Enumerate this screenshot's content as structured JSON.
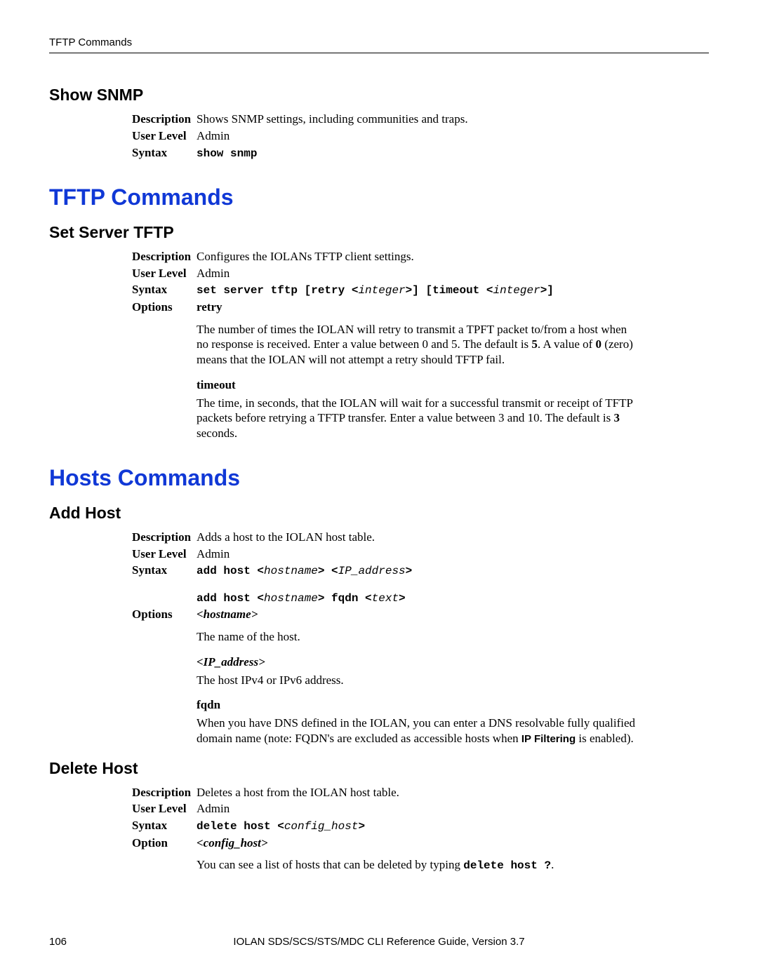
{
  "header": {
    "running": "TFTP Commands"
  },
  "show_snmp": {
    "heading": "Show SNMP",
    "desc_label": "Description",
    "desc": "Shows SNMP settings, including communities and traps.",
    "user_level_label": "User Level",
    "user_level": "Admin",
    "syntax_label": "Syntax",
    "syntax": "show snmp"
  },
  "tftp": {
    "heading": "TFTP Commands",
    "set_server": {
      "heading": "Set Server TFTP",
      "desc_label": "Description",
      "desc": "Configures the IOLANs TFTP client settings.",
      "user_level_label": "User Level",
      "user_level": "Admin",
      "syntax_label": "Syntax",
      "syntax_pre": "set server tftp [retry <",
      "syntax_i1": "integer",
      "syntax_mid": ">] [timeout <",
      "syntax_i2": "integer",
      "syntax_post": ">]",
      "options_label": "Options",
      "retry": {
        "title": "retry",
        "desc_pre": "The number of times the IOLAN will retry to transmit a TPFT packet to/from a host when no response is received. Enter a value between 0 and 5. The default is ",
        "desc_bold1": "5",
        "desc_mid": ". A value of ",
        "desc_bold2": "0",
        "desc_post": " (zero) means that the IOLAN will not attempt a retry should TFTP fail."
      },
      "timeout": {
        "title": "timeout",
        "desc_pre": "The time, in seconds, that the IOLAN will wait for a successful transmit or receipt of TFTP packets before retrying a TFTP transfer. Enter a value between 3 and 10. The default is ",
        "desc_bold": "3",
        "desc_post": " seconds."
      }
    }
  },
  "hosts": {
    "heading": "Hosts Commands",
    "add_host": {
      "heading": "Add Host",
      "desc_label": "Description",
      "desc": "Adds a host to the IOLAN host table.",
      "user_level_label": "User Level",
      "user_level": "Admin",
      "syntax_label": "Syntax",
      "syntax1_pre": "add host <",
      "syntax1_i1": "hostname",
      "syntax1_mid": "> <",
      "syntax1_i2": "IP_address",
      "syntax1_post": ">",
      "syntax2_pre": "add host <",
      "syntax2_i1": "hostname",
      "syntax2_mid": "> fqdn <",
      "syntax2_i2": "text",
      "syntax2_post": ">",
      "options_label": "Options",
      "opt_hostname": {
        "title": "<hostname>",
        "desc": "The name of the host."
      },
      "opt_ip": {
        "title": "<IP_address>",
        "desc": "The host IPv4 or IPv6 address."
      },
      "opt_fqdn": {
        "title": "fqdn",
        "desc_pre": "When you have DNS defined in the IOLAN, you can enter a DNS resolvable fully qualified domain name (note: FQDN's are excluded as accessible hosts when ",
        "desc_bold": "IP Filtering",
        "desc_post": " is enabled)."
      }
    },
    "delete_host": {
      "heading": "Delete Host",
      "desc_label": "Description",
      "desc": "Deletes a host from the IOLAN host table.",
      "user_level_label": "User Level",
      "user_level": "Admin",
      "syntax_label": "Syntax",
      "syntax_pre": "delete host <",
      "syntax_i": "config_host",
      "syntax_post": ">",
      "option_label": "Option",
      "opt_config_host": {
        "title": "<config_host>",
        "desc_pre": "You can see a list of hosts that can be deleted by typing ",
        "desc_mono": "delete host ?",
        "desc_post": "."
      }
    }
  },
  "footer": {
    "page": "106",
    "doc": "IOLAN SDS/SCS/STS/MDC CLI Reference Guide, Version 3.7"
  }
}
